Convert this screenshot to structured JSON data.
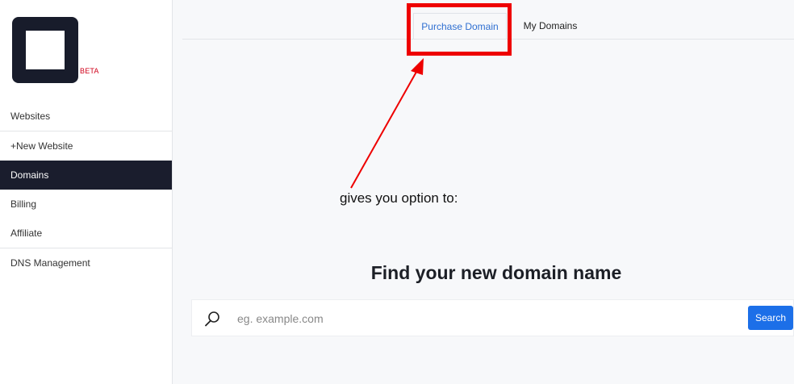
{
  "brand": {
    "badge": "BETA"
  },
  "sidebar": {
    "items": [
      {
        "label": "Websites"
      },
      {
        "label": "+New Website"
      },
      {
        "label": "Domains",
        "active": true
      },
      {
        "label": "Billing"
      },
      {
        "label": "Affiliate"
      },
      {
        "label": "DNS Management"
      }
    ]
  },
  "tabs": [
    {
      "label": "Purchase Domain",
      "active": true
    },
    {
      "label": "My Domains"
    }
  ],
  "annotation": {
    "text": "gives you option to:",
    "color": "#ee0000"
  },
  "main": {
    "heading": "Find your new domain name",
    "search": {
      "placeholder": "eg. example.com",
      "button_label": "Search",
      "icon": "search-icon"
    }
  },
  "colors": {
    "accent": "#1c6fe8",
    "sidebar_active": "#1a1d2d",
    "tab_active_text": "#2f6fd1"
  }
}
